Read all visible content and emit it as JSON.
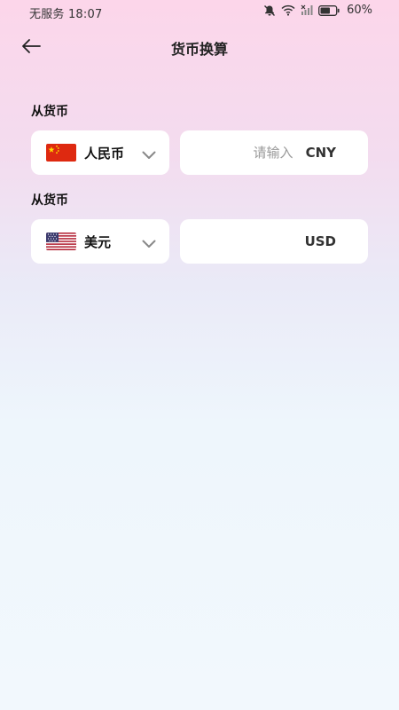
{
  "status_bar": {
    "carrier": "无服务",
    "time": "18:07",
    "battery": "60%",
    "icons": [
      "bell-muted-icon",
      "wifi-icon",
      "no-sim-icon",
      "battery-icon"
    ]
  },
  "header": {
    "title": "货币换算",
    "back_icon": "arrow-left-icon"
  },
  "from": {
    "label": "从货币",
    "currency_name": "人民币",
    "flag": "china-flag-icon",
    "input_value": "",
    "input_placeholder": "请输入",
    "code": "CNY"
  },
  "to": {
    "label": "从货币",
    "currency_name": "美元",
    "flag": "usa-flag-icon",
    "value": "",
    "code": "USD"
  },
  "colors": {
    "gradient_top": "#fcd6ea",
    "gradient_bottom": "#f2f8fd",
    "card": "#ffffff",
    "placeholder": "#9a9a9a"
  }
}
